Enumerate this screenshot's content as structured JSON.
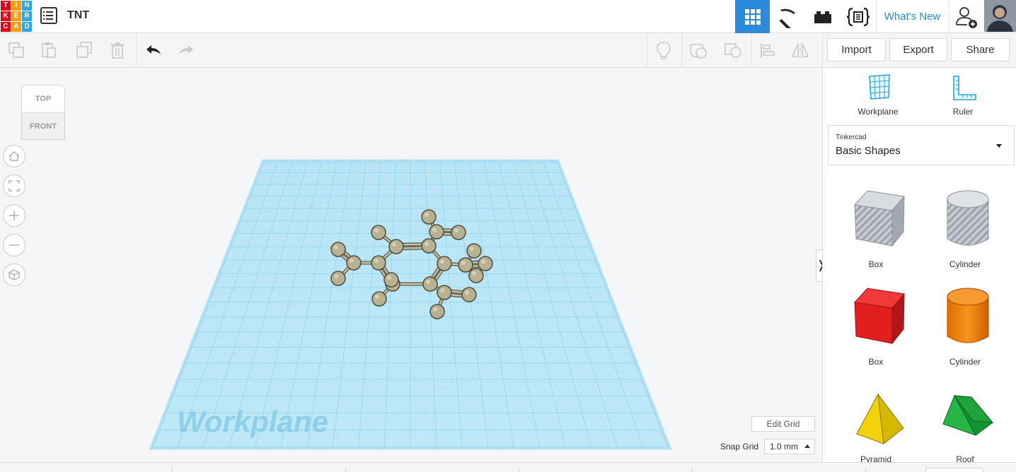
{
  "header": {
    "logo_letters": [
      "T",
      "I",
      "N",
      "K",
      "E",
      "R",
      "C",
      "A",
      "D"
    ],
    "logo_colors": [
      "#e2001a",
      "#f39c12",
      "#2ea7e0",
      "#e2001a",
      "#f39c12",
      "#2ea7e0",
      "#e2001a",
      "#f39c12",
      "#2ea7e0"
    ],
    "design_title": "TNT",
    "whats_new_label": "What's New",
    "active_view_color": "#2b8ad9"
  },
  "toolbar": {
    "import_label": "Import",
    "export_label": "Export",
    "share_label": "Share"
  },
  "viewport": {
    "viewcube_top": "TOP",
    "viewcube_front": "FRONT",
    "workplane_label": "Workplane",
    "edit_grid_label": "Edit Grid",
    "snap_grid_label": "Snap Grid",
    "snap_grid_value": "1.0 mm",
    "grid_color": "#8fd3ee",
    "atom_color": "#b8b292"
  },
  "panel": {
    "workplane_label": "Workplane",
    "ruler_label": "Ruler",
    "library_source": "Tinkercad",
    "library_name": "Basic Shapes",
    "shapes": [
      {
        "label": "Box",
        "color": "#b8bcc4",
        "icon": "box-hole-icon"
      },
      {
        "label": "Cylinder",
        "color": "#b8bcc4",
        "icon": "cylinder-hole-icon"
      },
      {
        "label": "Box",
        "color": "#e21f1f",
        "icon": "box-icon"
      },
      {
        "label": "Cylinder",
        "color": "#f07f0a",
        "icon": "cylinder-icon"
      },
      {
        "label": "Pyramid",
        "color": "#f2d20a",
        "icon": "pyramid-icon"
      },
      {
        "label": "Roof",
        "color": "#1ea23a",
        "icon": "roof-icon"
      }
    ]
  }
}
